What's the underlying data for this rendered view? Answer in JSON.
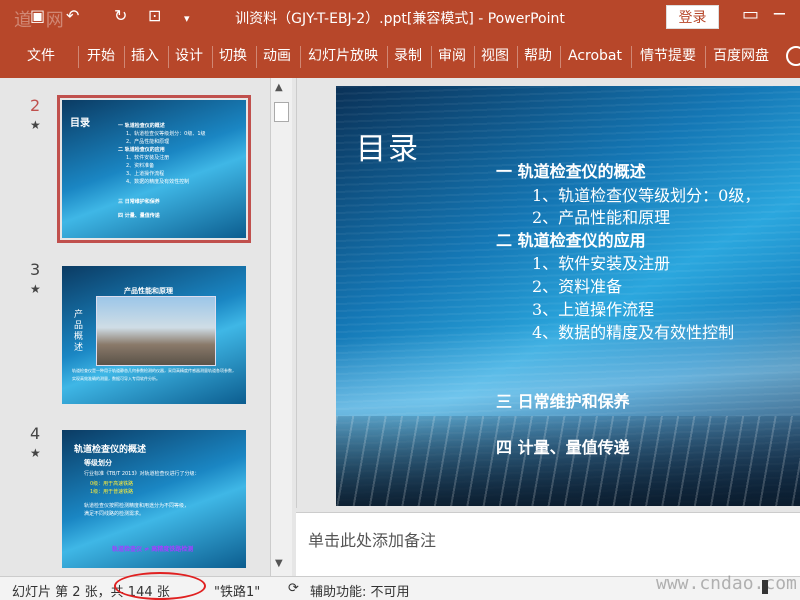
{
  "titlebar": {
    "title": "训资料（GJY-T-EBJ-2）.ppt[兼容模式]  -  PowerPoint",
    "login": "登录",
    "watermark": "道 网"
  },
  "ribbon": {
    "tabs": [
      "文件",
      "开始",
      "插入",
      "设计",
      "切换",
      "动画",
      "幻灯片放映",
      "录制",
      "审阅",
      "视图",
      "帮助",
      "Acrobat",
      "情节提要",
      "百度网盘"
    ]
  },
  "thumbnails": [
    {
      "num": "2",
      "star": "★",
      "selected": true,
      "title": "目录",
      "lines": [
        "一  轨道检查仪的概述",
        "1、轨道检查仪等级划分：0级、1级",
        "2、产品性能和原理",
        "二  轨道检查仪的应用",
        "1、软件安装及注册",
        "2、资料准备",
        "3、上道操作流程",
        "4、数据的精度及有效性控制",
        "三  日常维护和保养",
        "四  计量、量值传递"
      ]
    },
    {
      "num": "3",
      "star": "★",
      "selected": false,
      "title": "产品性能和原理",
      "vertical": "产品概述",
      "lines": [
        "轨道检查仪是一种用于轨道静态几何参数检测的仪器，采用高精度传感器测量轨道各项参数，",
        "实现高效准确的测量，数据可导入专用软件分析。"
      ]
    },
    {
      "num": "4",
      "star": "★",
      "selected": false,
      "title": "轨道检查仪的概述",
      "lines": [
        "等级划分",
        "行业标准《TB/T 2013》对轨道检查仪进行了分级：",
        "0级：用于高速铁路",
        "1级：用于普速铁路",
        "轨道检查仪按照检测精度和用途分为不同等级，",
        "满足不同线路的检测需求。"
      ],
      "footer": "轨道检查仪 ≠ 高精度铁路检测"
    }
  ],
  "slide": {
    "title": "目录",
    "lines": [
      {
        "text": "一   轨道检查仪的概述",
        "bold": true
      },
      {
        "text": "1、轨道检查仪等级划分：0级，",
        "bold": false
      },
      {
        "text": "2、产品性能和原理",
        "bold": false
      },
      {
        "text": "二   轨道检查仪的应用",
        "bold": true
      },
      {
        "text": "1、软件安装及注册",
        "bold": false
      },
      {
        "text": "2、资料准备",
        "bold": false
      },
      {
        "text": "3、上道操作流程",
        "bold": false
      },
      {
        "text": "4、数据的精度及有效性控制",
        "bold": false
      },
      {
        "text": "三   日常维护和保养",
        "bold": true
      },
      {
        "text": "四   计量、量值传递",
        "bold": true
      }
    ]
  },
  "notes": {
    "placeholder": "单击此处添加备注"
  },
  "statusbar": {
    "slide_info": "幻灯片 第 2 张，共 144 张",
    "theme": "\"铁路1\"",
    "accessibility": "辅助功能: 不可用",
    "watermark": "www.cndao.com"
  },
  "colors": {
    "accent": "#b7472a",
    "highlight": "#e02020"
  }
}
